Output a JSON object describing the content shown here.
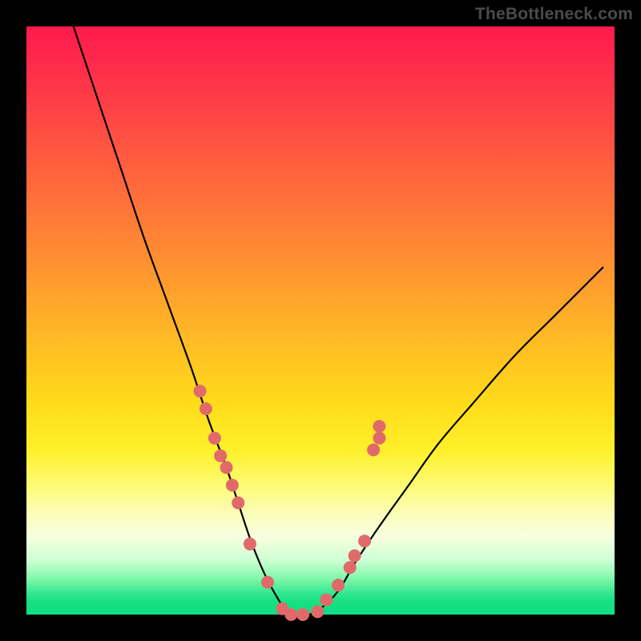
{
  "watermark": "TheBottleneck.com",
  "chart_data": {
    "type": "line",
    "title": "",
    "xlabel": "",
    "ylabel": "",
    "xlim": [
      0,
      100
    ],
    "ylim": [
      0,
      100
    ],
    "grid": false,
    "legend": false,
    "series": [
      {
        "name": "bottleneck-curve",
        "x": [
          8,
          12,
          16,
          20,
          24,
          28,
          31,
          34,
          36,
          38,
          40,
          42,
          44,
          46,
          48,
          50,
          53,
          56,
          60,
          65,
          70,
          76,
          83,
          90,
          98
        ],
        "y": [
          100,
          88,
          76,
          64,
          53,
          42,
          33,
          25,
          19,
          13,
          8,
          4,
          1,
          0,
          0,
          1,
          4,
          9,
          15,
          22,
          29,
          36,
          44,
          51,
          59
        ]
      }
    ],
    "markers": {
      "name": "marker-dots",
      "color": "#e06a6a",
      "x": [
        29.5,
        30.5,
        32.0,
        33.0,
        34.0,
        35.0,
        36.0,
        38.0,
        41.0,
        43.5,
        45.0,
        47.0,
        49.5,
        51.0,
        53.0,
        55.0,
        55.8,
        57.5,
        59.0,
        60.0,
        60.0
      ],
      "y": [
        38.0,
        35.0,
        30.0,
        27.0,
        25.0,
        22.0,
        19.0,
        12.0,
        5.5,
        1.0,
        0.0,
        0.0,
        0.5,
        2.5,
        5.0,
        8.0,
        10.0,
        12.5,
        28.0,
        30.0,
        32.0
      ]
    },
    "marker_radius_px": 8
  },
  "colors": {
    "curve_stroke": "#000000",
    "marker_fill": "#e06a6a",
    "background_black": "#000000"
  }
}
